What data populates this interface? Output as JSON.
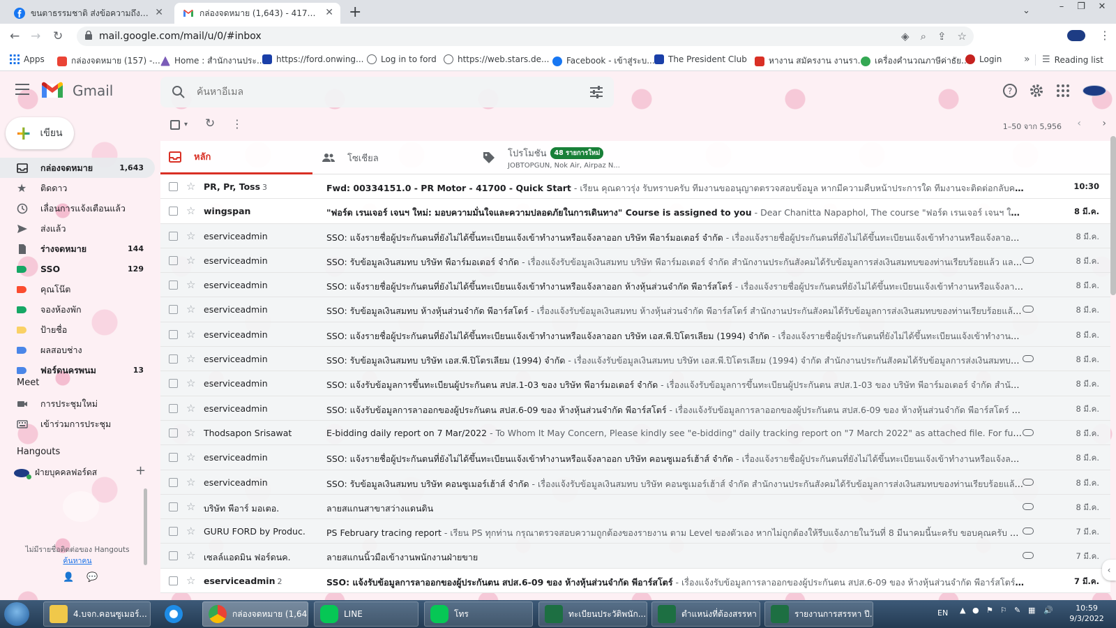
{
  "browser": {
    "tabs": [
      {
        "title": "ขนตาธรรมชาติ ส่งข้อความถึงคุณ",
        "icon": "facebook-icon"
      },
      {
        "title": "กล่องจดหมาย (1,643) - 41700.hr@...",
        "icon": "gmail-icon",
        "active": true
      }
    ],
    "url": "mail.google.com/mail/u/0/#inbox",
    "bookmarks": [
      {
        "label": "Apps",
        "icon": "apps-grid-icon"
      },
      {
        "label": "กล่องจดหมาย (157) -...",
        "icon": "gmail-icon"
      },
      {
        "label": "Home : สำนักงานประ...",
        "icon": "triangle-logo-icon"
      },
      {
        "label": "https://ford.onwing...",
        "icon": "check-logo-icon"
      },
      {
        "label": "Log in to ford",
        "icon": "globe-icon"
      },
      {
        "label": "https://web.stars.de...",
        "icon": "globe-icon"
      },
      {
        "label": "Facebook - เข้าสู่ระบ...",
        "icon": "facebook-icon"
      },
      {
        "label": "The President Club",
        "icon": "check-logo-icon"
      },
      {
        "label": "หางาน สมัครงาน งานรา...",
        "icon": "jobthai-icon"
      },
      {
        "label": "เครื่องคำนวณภาษีค่าธัย...",
        "icon": "calculator-icon"
      },
      {
        "label": "Login",
        "icon": "login-icon"
      }
    ],
    "reading_list": "Reading list"
  },
  "gmail": {
    "wordmark": "Gmail",
    "search_placeholder": "ค้นหาอีเมล",
    "compose_label": "เขียน",
    "nav": [
      {
        "label": "กล่องจดหมาย",
        "count": "1,643",
        "icon": "inbox-icon",
        "active": true
      },
      {
        "label": "ติดดาว",
        "count": "",
        "icon": "star-icon"
      },
      {
        "label": "เลื่อนการแจ้งเตือนแล้ว",
        "count": "",
        "icon": "clock-icon"
      },
      {
        "label": "ส่งแล้ว",
        "count": "",
        "icon": "send-icon"
      },
      {
        "label": "ร่างจดหมาย",
        "count": "144",
        "icon": "draft-icon",
        "bold": true
      },
      {
        "label": "SSO",
        "count": "129",
        "icon": "label-icon",
        "color": "#16a765",
        "bold": true
      },
      {
        "label": "คุณโน๊ต",
        "count": "",
        "icon": "label-icon",
        "color": "#fb4c2f"
      },
      {
        "label": "จองห้องพัก",
        "count": "",
        "icon": "label-icon",
        "color": "#16a765"
      },
      {
        "label": "ป้ายชื่อ",
        "count": "",
        "icon": "label-icon",
        "color": "#fad165"
      },
      {
        "label": "ผลสอบช่าง",
        "count": "",
        "icon": "label-icon",
        "color": "#4a86e8"
      },
      {
        "label": "ฟอร์ดนครพนม",
        "count": "13",
        "icon": "label-icon",
        "color": "#4a86e8",
        "bold": true
      }
    ],
    "meet": {
      "title": "Meet",
      "items": [
        {
          "label": "การประชุมใหม่",
          "icon": "video-camera-icon"
        },
        {
          "label": "เข้าร่วมการประชุม",
          "icon": "keyboard-icon"
        }
      ]
    },
    "hangouts": {
      "title": "Hangouts",
      "user": "ฝ่ายบุคคลฟอร์ดส",
      "empty_text": "ไม่มีรายชื่อติดต่อของ Hangouts",
      "find_link": "ค้นหาคน"
    },
    "pager": "1–50 จาก 5,956",
    "tabs": {
      "primary": "หลัก",
      "social": "โซเชียล",
      "promo": "โปรโมชัน",
      "promo_badge": "48 รายการใหม่",
      "promo_senders": "JOBTOPGUN, Nok Air, Airpaz N..."
    },
    "emails": [
      {
        "sender": "PR, Pr, Toss",
        "count": "3",
        "subject": "Fwd: 00334151.0 - PR Motor - 41700 - Quick Start",
        "snippet": " - เรียน คุณดาวรุ่ง รับทราบครับ ทีมงานขออนุญาตตรวจสอบข้อมูล หากมีความคืบหน้าประการใด ทีมงานจะติดต่อกลับครับ ขอบคุณครับ ท...",
        "date": "10:30",
        "unread": true,
        "attachment": false
      },
      {
        "sender": "wingspan",
        "count": "",
        "subject": "\"ฟอร์ด เรนเจอร์ เจนฯ ใหม่: มอบความมั่นใจและความปลอดภัยในการเดินทาง\" Course is assigned to you",
        "snippet": " - Dear Chanitta Napaphol, The course \"ฟอร์ด เรนเจอร์ เจนฯ ใหม่: มอบควา...",
        "date": "8 มี.ค.",
        "unread": true,
        "attachment": false
      },
      {
        "sender": "eserviceadmin",
        "count": "",
        "subject": "SSO: แจ้งรายชื่อผู้ประกันตนที่ยังไม่ได้ขึ้นทะเบียนแจ้งเข้าทำงานหรือแจ้งลาออก บริษัท พีอาร์มอเตอร์ จำกัด",
        "snippet": " - เรื่องแจ้งรายชื่อผู้ประกันตนที่ยังไม่ได้ขึ้นทะเบียนแจ้งเข้าทำงานหรือแจ้งลาออก บริษั...",
        "date": "8 มี.ค.",
        "unread": false,
        "attachment": false
      },
      {
        "sender": "eserviceadmin",
        "count": "",
        "subject": "SSO: รับข้อมูลเงินสมทบ บริษัท พีอาร์มอเตอร์ จำกัด",
        "snippet": " - เรื่องแจ้งรับข้อมูลเงินสมทบ บริษัท พีอาร์มอเตอร์ จำกัด สำนักงานประกันสังคมได้รับข้อมูลการส่งเงินสมทบของท่านเรียบร้อยแล้ว และได้แน...",
        "date": "8 มี.ค.",
        "unread": false,
        "attachment": true
      },
      {
        "sender": "eserviceadmin",
        "count": "",
        "subject": "SSO: แจ้งรายชื่อผู้ประกันตนที่ยังไม่ได้ขึ้นทะเบียนแจ้งเข้าทำงานหรือแจ้งลาออก ห้างหุ้นส่วนจำกัด พีอาร์สโตร์",
        "snippet": " - เรื่องแจ้งรายชื่อผู้ประกันตนที่ยังไม่ได้ขึ้นทะเบียนแจ้งเข้าทำงานหรือแจ้งลาออก ห้า...",
        "date": "8 มี.ค.",
        "unread": false,
        "attachment": false
      },
      {
        "sender": "eserviceadmin",
        "count": "",
        "subject": "SSO: รับข้อมูลเงินสมทบ ห้างหุ้นส่วนจำกัด พีอาร์สโตร์",
        "snippet": " - เรื่องแจ้งรับข้อมูลเงินสมทบ ห้างหุ้นส่วนจำกัด พีอาร์สโตร์ สำนักงานประกันสังคมได้รับข้อมูลการส่งเงินสมทบของท่านเรียบร้อยแล้ว และได้...",
        "date": "8 มี.ค.",
        "unread": false,
        "attachment": true
      },
      {
        "sender": "eserviceadmin",
        "count": "",
        "subject": "SSO: แจ้งรายชื่อผู้ประกันตนที่ยังไม่ได้ขึ้นทะเบียนแจ้งเข้าทำงานหรือแจ้งลาออก บริษัท เอส.พี.ปิโตรเลียม (1994) จำกัด",
        "snippet": " - เรื่องแจ้งรายชื่อผู้ประกันตนที่ยังไม่ได้ขึ้นทะเบียนแจ้งเข้าทำงานหรือแจ้ง...",
        "date": "8 มี.ค.",
        "unread": false,
        "attachment": false
      },
      {
        "sender": "eserviceadmin",
        "count": "",
        "subject": "SSO: รับข้อมูลเงินสมทบ บริษัท เอส.พี.ปิโตรเลียม (1994) จำกัด",
        "snippet": " - เรื่องแจ้งรับข้อมูลเงินสมทบ บริษัท เอส.พี.ปิโตรเลียม (1994) จำกัด สำนักงานประกันสังคมได้รับข้อมูลการส่งเงินสมทบของท่าน...",
        "date": "8 มี.ค.",
        "unread": false,
        "attachment": true
      },
      {
        "sender": "eserviceadmin",
        "count": "",
        "subject": "SSO: แจ้งรับข้อมูลการขึ้นทะเบียนผู้ประกันตน สปส.1-03 ของ บริษัท พีอาร์มอเตอร์ จำกัด",
        "snippet": " - เรื่องแจ้งรับข้อมูลการขึ้นทะเบียนผู้ประกันตน สปส.1-03 ของ บริษัท พีอาร์มอเตอร์ จำกัด สำนักงานประกั...",
        "date": "8 มี.ค.",
        "unread": false,
        "attachment": false
      },
      {
        "sender": "eserviceadmin",
        "count": "",
        "subject": "SSO: แจ้งรับข้อมูลการลาออกของผู้ประกันตน สปส.6-09 ของ ห้างหุ้นส่วนจำกัด พีอาร์สโตร์",
        "snippet": " - เรื่องแจ้งรับข้อมูลการลาออกของผู้ประกันตน สปส.6-09 ของ ห้างหุ้นส่วนจำกัด พีอาร์สโตร์ สำนักงาน...",
        "date": "8 มี.ค.",
        "unread": false,
        "attachment": false
      },
      {
        "sender": "Thodsapon Srisawat",
        "count": "",
        "subject": "E-bidding daily report on 7 Mar/2022",
        "snippet": " - To Whom It May Concern, Please kindly see \"e-bidding\" daily tracking report on \"7 March 2022\" as attached file. For further information ...",
        "date": "8 มี.ค.",
        "unread": false,
        "attachment": true
      },
      {
        "sender": "eserviceadmin",
        "count": "",
        "subject": "SSO: แจ้งรายชื่อผู้ประกันตนที่ยังไม่ได้ขึ้นทะเบียนแจ้งเข้าทำงานหรือแจ้งลาออก บริษัท คอนซูเมอร์เฮ้าส์ จำกัด",
        "snippet": " - เรื่องแจ้งรายชื่อผู้ประกันตนที่ยังไม่ได้ขึ้นทะเบียนแจ้งเข้าทำงานหรือแจ้งลาออก บ...",
        "date": "8 มี.ค.",
        "unread": false,
        "attachment": false
      },
      {
        "sender": "eserviceadmin",
        "count": "",
        "subject": "SSO: รับข้อมูลเงินสมทบ บริษัท คอนซูเมอร์เฮ้าส์ จำกัด",
        "snippet": " - เรื่องแจ้งรับข้อมูลเงินสมทบ บริษัท คอนซูเมอร์เฮ้าส์ จำกัด สำนักงานประกันสังคมได้รับข้อมูลการส่งเงินสมทบของท่านเรียบร้อยแล้ว และได้...",
        "date": "8 มี.ค.",
        "unread": false,
        "attachment": true
      },
      {
        "sender": "บริษัท พีอาร์ มอเตอ.",
        "count": "",
        "subject": "ลายสแกนสาขาสว่างแดนดิน",
        "snippet": "",
        "date": "8 มี.ค.",
        "unread": false,
        "attachment": true
      },
      {
        "sender": "GURU FORD by Produc.",
        "count": "",
        "subject": "PS February tracing report",
        "snippet": " - เรียน PS ทุกท่าน กรุณาตรวจสอบความถูกต้องของรายงาน ตาม Level ของตัวเอง หากไม่ถูกต้องให้รีบแจ้งภายในวันที่ 8 มีนาคมนี้นะครับ ขอบคุณครับ ณัฏฐ์",
        "date": "7 มี.ค.",
        "unread": false,
        "attachment": true
      },
      {
        "sender": "เซลล์แอดมิน ฟอร์ดนค.",
        "count": "",
        "subject": "ลายสแกนนิ้วมือเข้างานพนักงานฝ่ายขาย",
        "snippet": "",
        "date": "7 มี.ค.",
        "unread": false,
        "attachment": true
      },
      {
        "sender": "eserviceadmin",
        "count": "2",
        "subject": "SSO: แจ้งรับข้อมูลการลาออกของผู้ประกันตน สปส.6-09 ของ ห้างหุ้นส่วนจำกัด พีอาร์สโตร์",
        "snippet": " - เรื่องแจ้งรับข้อมูลการลาออกของผู้ประกันตน สปส.6-09 ของ ห้างหุ้นส่วนจำกัด พีอาร์สโตร์ สำ...",
        "date": "7 มี.ค.",
        "unread": true,
        "attachment": false
      }
    ]
  },
  "taskbar": {
    "items": [
      {
        "label": "4.บจก.คอนซูเมอร์...",
        "icon": "folder-icon"
      },
      {
        "label": "",
        "icon": "internet-explorer-icon"
      },
      {
        "label": "กล่องจดหมาย (1,64...",
        "icon": "chrome-icon"
      },
      {
        "label": "LINE",
        "icon": "line-icon"
      },
      {
        "label": "โทร",
        "icon": "phone-icon"
      },
      {
        "label": "ทะเบียนประวัติพนัก...",
        "icon": "excel-icon"
      },
      {
        "label": "ตำแหน่งที่ต้องสรรหา",
        "icon": "excel-icon"
      },
      {
        "label": "รายงานการสรรหา ปี...",
        "icon": "excel-icon"
      }
    ],
    "lang": "EN",
    "time": "10:59",
    "date": "9/3/2022"
  }
}
